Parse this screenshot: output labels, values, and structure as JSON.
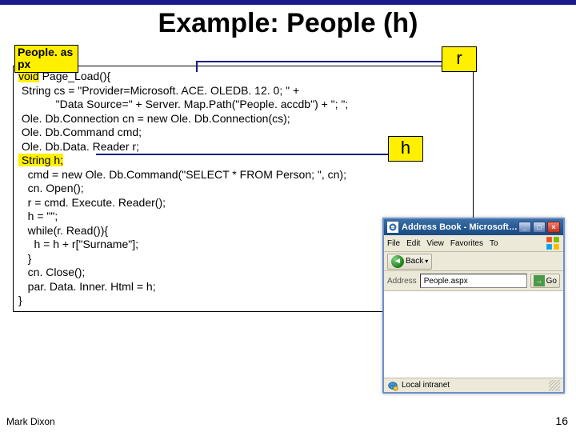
{
  "slide": {
    "title": "Example: People (h)",
    "filename_label": "People. as px",
    "footer_author": "Mark Dixon",
    "page_number": "16",
    "colors": {
      "rule": "#1a1a8a",
      "highlight": "#fff000"
    }
  },
  "callouts": {
    "r": "r",
    "h": "h"
  },
  "code": {
    "line1_prefix": "void",
    "line1_rest": " Page_Load(){",
    "line2": " String cs = \"Provider=Microsoft. ACE. OLEDB. 12. 0; \" +",
    "line3": "            \"Data Source=\" + Server. Map.Path(\"People. accdb\") + \"; \";",
    "line4": " Ole. Db.Connection cn = new Ole. Db.Connection(cs);",
    "line5": " Ole. Db.Command cmd;",
    "line6": " Ole. Db.Data. Reader r;",
    "line7_hl": " String h;",
    "line8": "   cmd = new Ole. Db.Command(\"SELECT * FROM Person; \", cn);",
    "line9": "   cn. Open();",
    "line10": "   r = cmd. Execute. Reader();",
    "line11": "   h = \"\";",
    "line12": "   while(r. Read()){",
    "line13": "     h = h + r[\"Surname\"];",
    "line14": "   }",
    "line15": "   cn. Close();",
    "line16": "   par. Data. Inner. Html = h;",
    "line17": "}"
  },
  "browser": {
    "title": "Address Book - Microsoft I…",
    "menus": [
      "File",
      "Edit",
      "View",
      "Favorites",
      "To"
    ],
    "back_label": "Back",
    "address_label": "Address",
    "address_value": "People.aspx",
    "go_label": "Go",
    "status_text": "Local intranet",
    "window_buttons": {
      "min": "_",
      "max": "□",
      "close": "×"
    }
  }
}
